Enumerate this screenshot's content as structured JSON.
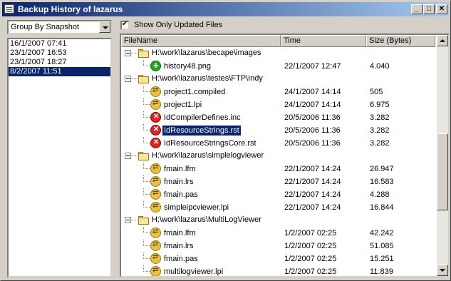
{
  "window": {
    "title": "Backup History of lazarus"
  },
  "left": {
    "group_select": "Group By Snapshot",
    "snapshots": [
      "16/1/2007 07:41",
      "23/1/2007 16:53",
      "23/1/2007 18:27",
      "8/2/2007 11:51"
    ],
    "selected_index": 3
  },
  "filter": {
    "show_only_updated_label": "Show Only Updated Files",
    "checked": true
  },
  "columns": {
    "filename": "FileName",
    "time": "Time",
    "size": "Size (Bytes)"
  },
  "rows": [
    {
      "type": "dir",
      "name": "H:\\work\\lazarus\\becape\\images"
    },
    {
      "type": "file",
      "status": "added",
      "name": "history48.png",
      "time": "22/1/2007 12:47",
      "size": "4.040"
    },
    {
      "type": "dir",
      "name": "H:\\work\\lazarus\\testes\\FTP\\Indy"
    },
    {
      "type": "file",
      "status": "modified",
      "name": "project1.compiled",
      "time": "24/1/2007 14:14",
      "size": "505"
    },
    {
      "type": "file",
      "status": "modified",
      "name": "project1.lpi",
      "time": "24/1/2007 14:14",
      "size": "6.975"
    },
    {
      "type": "file",
      "status": "deleted",
      "name": "IdCompilerDefines.inc",
      "time": "20/5/2006 11:36",
      "size": "3.282"
    },
    {
      "type": "file",
      "status": "deleted",
      "name": "IdResourceStrings.rst",
      "time": "20/5/2006 11:36",
      "size": "3.282",
      "selected": true
    },
    {
      "type": "file",
      "status": "deleted",
      "name": "IdResourceStringsCore.rst",
      "time": "20/5/2006 11:36",
      "size": "3.282"
    },
    {
      "type": "dir",
      "name": "H:\\work\\lazarus\\simplelogviewer"
    },
    {
      "type": "file",
      "status": "modified",
      "name": "fmain.lfm",
      "time": "22/1/2007 14:24",
      "size": "26.947"
    },
    {
      "type": "file",
      "status": "modified",
      "name": "fmain.lrs",
      "time": "22/1/2007 14:24",
      "size": "16.583"
    },
    {
      "type": "file",
      "status": "modified",
      "name": "fmain.pas",
      "time": "22/1/2007 14:24",
      "size": "4.288"
    },
    {
      "type": "file",
      "status": "modified",
      "name": "simpleipcviewer.lpi",
      "time": "22/1/2007 14:24",
      "size": "16.844"
    },
    {
      "type": "dir",
      "name": "H:\\work\\lazarus\\MultiLogViewer"
    },
    {
      "type": "file",
      "status": "modified",
      "name": "fmain.lfm",
      "time": "1/2/2007 02:25",
      "size": "42.242"
    },
    {
      "type": "file",
      "status": "modified",
      "name": "fmain.lrs",
      "time": "1/2/2007 02:25",
      "size": "51.085"
    },
    {
      "type": "file",
      "status": "modified",
      "name": "fmain.pas",
      "time": "1/2/2007 02:25",
      "size": "15.251"
    },
    {
      "type": "file",
      "status": "modified",
      "name": "multilogviewer.lpi",
      "time": "1/2/2007 02:25",
      "size": "11.839"
    }
  ]
}
